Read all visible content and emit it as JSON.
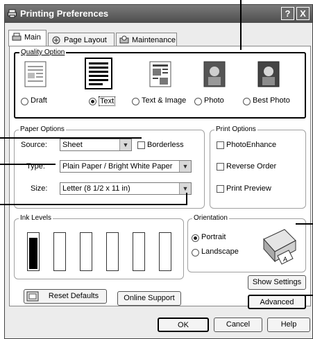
{
  "window": {
    "title": "Printing Preferences",
    "help_label": "?",
    "close_label": "X"
  },
  "tabs": [
    {
      "label": "Main",
      "icon": "printer-icon"
    },
    {
      "label": "Page Layout",
      "icon": "page-layout-icon"
    },
    {
      "label": "Maintenance",
      "icon": "maintenance-icon"
    }
  ],
  "quality": {
    "legend": "Quality Option",
    "options": [
      {
        "label": "Draft",
        "selected": false
      },
      {
        "label": "Text",
        "selected": true
      },
      {
        "label": "Text & Image",
        "selected": false
      },
      {
        "label": "Photo",
        "selected": false
      },
      {
        "label": "Best Photo",
        "selected": false
      }
    ]
  },
  "paper": {
    "legend": "Paper Options",
    "source_label": "Source:",
    "source_value": "Sheet",
    "borderless_label": "Borderless",
    "borderless_checked": false,
    "type_label": "Type:",
    "type_value": "Plain Paper / Bright White Paper",
    "size_label": "Size:",
    "size_value": "Letter (8 1/2 x 11 in)"
  },
  "print_options": {
    "legend": "Print Options",
    "photoenhance_label": "PhotoEnhance",
    "reverse_label": "Reverse Order",
    "preview_label": "Print Preview"
  },
  "ink": {
    "legend": "Ink Levels",
    "cartridges": [
      {
        "color": "#000000",
        "level": 0.9
      },
      {
        "color": "#000000",
        "level": 0.0
      },
      {
        "color": "#000000",
        "level": 0.0
      },
      {
        "color": "#000000",
        "level": 0.0
      },
      {
        "color": "#000000",
        "level": 0.0
      },
      {
        "color": "#000000",
        "level": 0.0
      }
    ]
  },
  "orientation": {
    "legend": "Orientation",
    "portrait_label": "Portrait",
    "landscape_label": "Landscape",
    "selected": "Portrait"
  },
  "buttons": {
    "show_settings": "Show Settings",
    "advanced": "Advanced",
    "reset_defaults": "Reset Defaults",
    "online_support": "Online Support",
    "ok": "OK",
    "cancel": "Cancel",
    "help": "Help"
  },
  "colors": {
    "titlebar": "#5a5a5a",
    "panel": "#ffffff",
    "dialog": "#ececec"
  }
}
